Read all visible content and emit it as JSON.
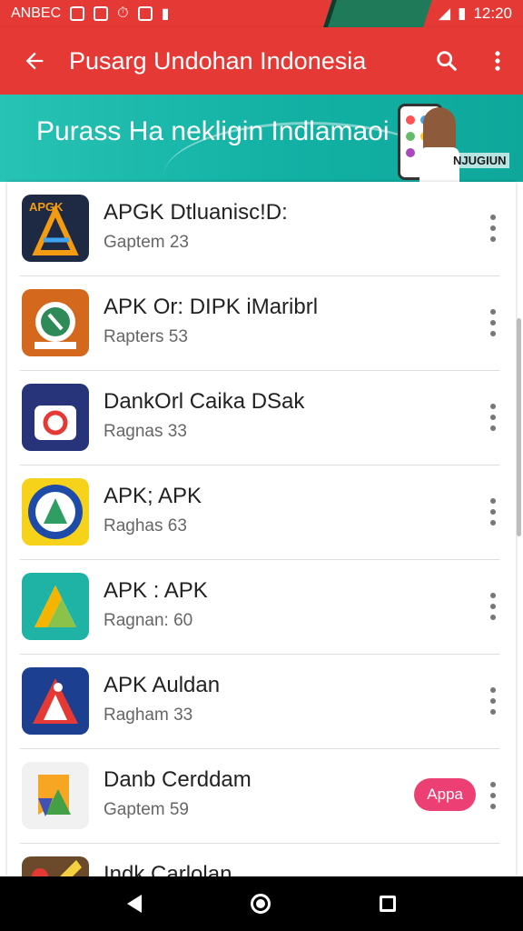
{
  "status_bar": {
    "carrier": "ANBEC",
    "time": "12:20"
  },
  "app_bar": {
    "title": "Pusarg Undohan Indonesia",
    "back_icon": "arrow-left-icon",
    "search_icon": "search-icon",
    "more_icon": "more-vert-icon"
  },
  "banner": {
    "text": "Purass Ha nekligin Indlamaoi",
    "sub_text": "NJUGIUN"
  },
  "apps": [
    {
      "name": "APGK Dtluanisc!D:",
      "subtitle": "Gaptem 23",
      "icon": "apgk-app-icon"
    },
    {
      "name": "APK Or: DIPK iMaribrl",
      "subtitle": "Rapters 53",
      "icon": "pk-app-icon"
    },
    {
      "name": "DankOrl Caika DSak",
      "subtitle": "Ragnas 33",
      "icon": "camera-app-icon"
    },
    {
      "name": "APK; APK",
      "subtitle": "Raghas 63",
      "icon": "seal-app-icon"
    },
    {
      "name": "APK : APK",
      "subtitle": "Ragnan: 60",
      "icon": "triangle-app-icon"
    },
    {
      "name": "APK Auldan",
      "subtitle": "Ragham 33",
      "icon": "runner-app-icon"
    },
    {
      "name": "Danb Cerddam",
      "subtitle": "Gaptem 59",
      "icon": "flag-app-icon",
      "badge": "Appa"
    },
    {
      "name": "Indk Carlolan",
      "subtitle": "",
      "icon": "game-app-icon"
    }
  ],
  "colors": {
    "primary": "#e53935",
    "banner": "#12b1a4",
    "badge": "#ec3f74"
  }
}
